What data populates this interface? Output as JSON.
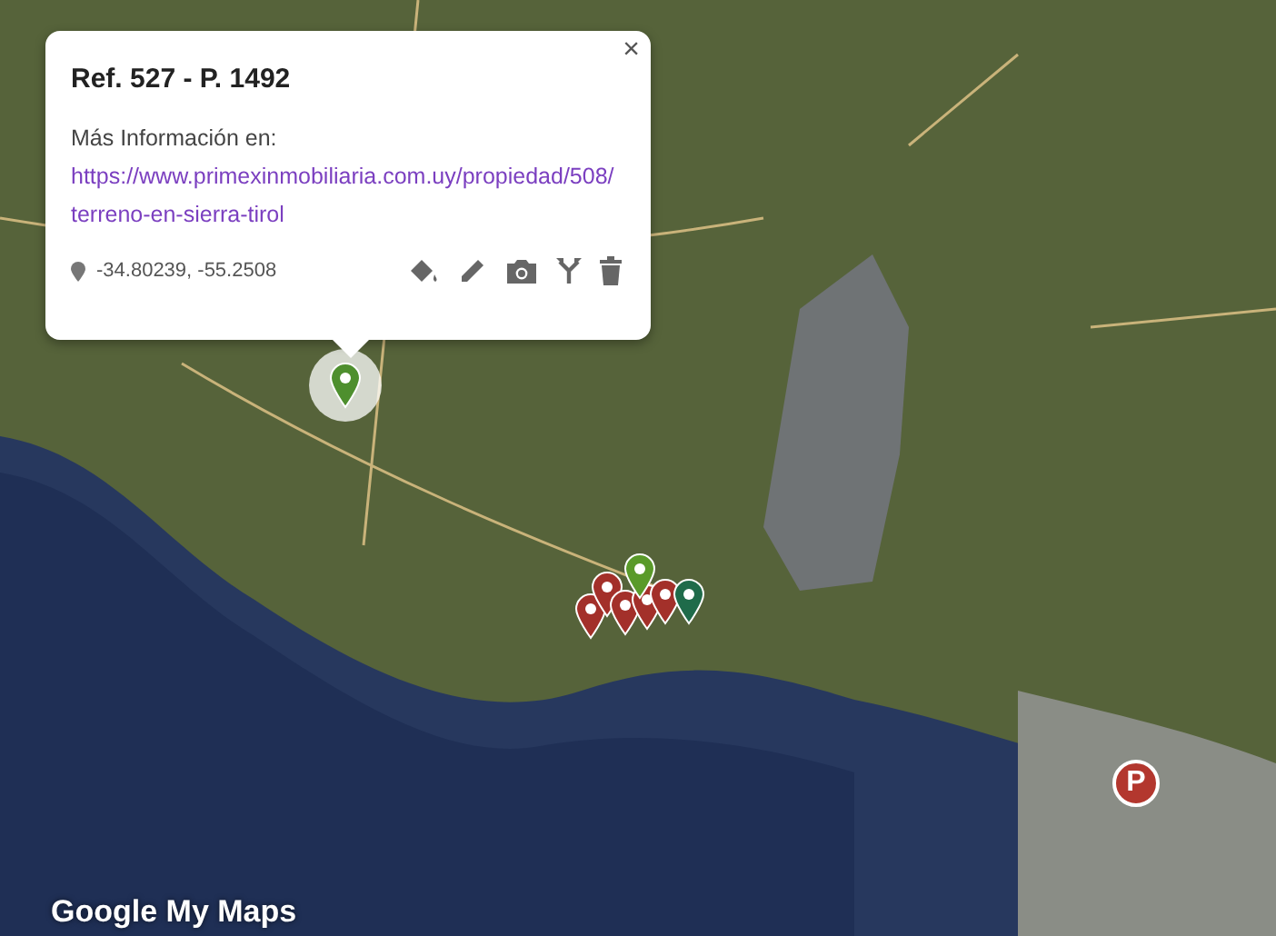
{
  "popup": {
    "title": "Ref. 527 - P. 1492",
    "info_text": "Más Información en:",
    "link": "https://www.primexinmobiliaria.com.uy/propiedad/508/terreno-en-sierra-tirol",
    "coordinates": "-34.80239, -55.2508",
    "close": "×"
  },
  "markers": [
    {
      "color": "#4e8f2e",
      "selected": true
    },
    {
      "color": "#a3302a",
      "selected": false
    },
    {
      "color": "#a3302a",
      "selected": false
    },
    {
      "color": "#a3302a",
      "selected": false
    },
    {
      "color": "#a3302a",
      "selected": false
    },
    {
      "color": "#a3302a",
      "selected": false
    },
    {
      "color": "#5a9a2a",
      "selected": false
    },
    {
      "color": "#1f6b4a",
      "selected": false
    }
  ],
  "parking_marker": {
    "label": "P"
  },
  "logo": "Google My Maps"
}
